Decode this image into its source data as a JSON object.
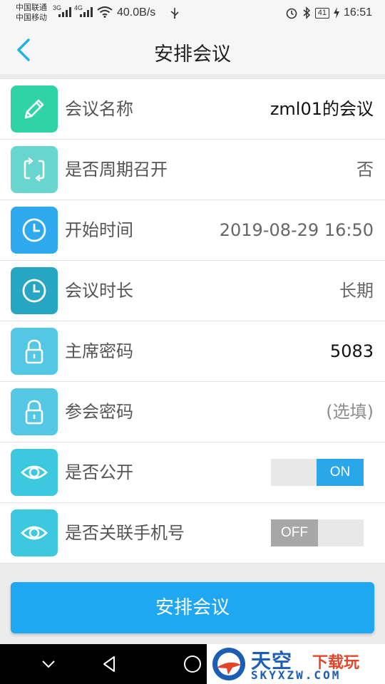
{
  "status_bar": {
    "carrier_1": "中国联通",
    "carrier_2": "中国移动",
    "signal_1": "3G",
    "signal_2": "4G",
    "net_speed": "40.0B/s",
    "battery": "41",
    "time": "16:51"
  },
  "nav": {
    "title": "安排会议",
    "back_icon": "chevron-left-icon"
  },
  "form": {
    "rows": [
      {
        "icon": "pencil-icon",
        "color": "#2fd3a6",
        "label": "会议名称",
        "value": "zml01的会议"
      },
      {
        "icon": "repeat-icon",
        "color": "#69d5cf",
        "label": "是否周期召开",
        "value": "否"
      },
      {
        "icon": "clock-icon",
        "color": "#2ea9f0",
        "label": "开始时间",
        "value": "2019-08-29 16:50"
      },
      {
        "icon": "clock-icon",
        "color": "#26a6c2",
        "label": "会议时长",
        "value": "长期"
      },
      {
        "icon": "lock-icon",
        "color": "#53c7e3",
        "label": "主席密码",
        "value": "5083"
      },
      {
        "icon": "lock-icon",
        "color": "#53c7e3",
        "label": "参会密码",
        "placeholder": "(选填)"
      },
      {
        "icon": "eye-icon",
        "color": "#3cc9e0",
        "label": "是否公开",
        "toggle": "ON",
        "toggle_on": true
      },
      {
        "icon": "eye-icon",
        "color": "#3cc9e0",
        "label": "是否关联手机号",
        "toggle": "OFF",
        "toggle_on": false
      }
    ]
  },
  "submit_button": {
    "label": "安排会议",
    "color": "#1fa7f2"
  },
  "system_nav": {
    "back": "triangle-back-icon",
    "home": "circle-home-icon",
    "down": "chevron-down-icon"
  },
  "watermark": {
    "title": "天空",
    "subtitle": "下载玩",
    "url": "SKYXZW.COM"
  }
}
